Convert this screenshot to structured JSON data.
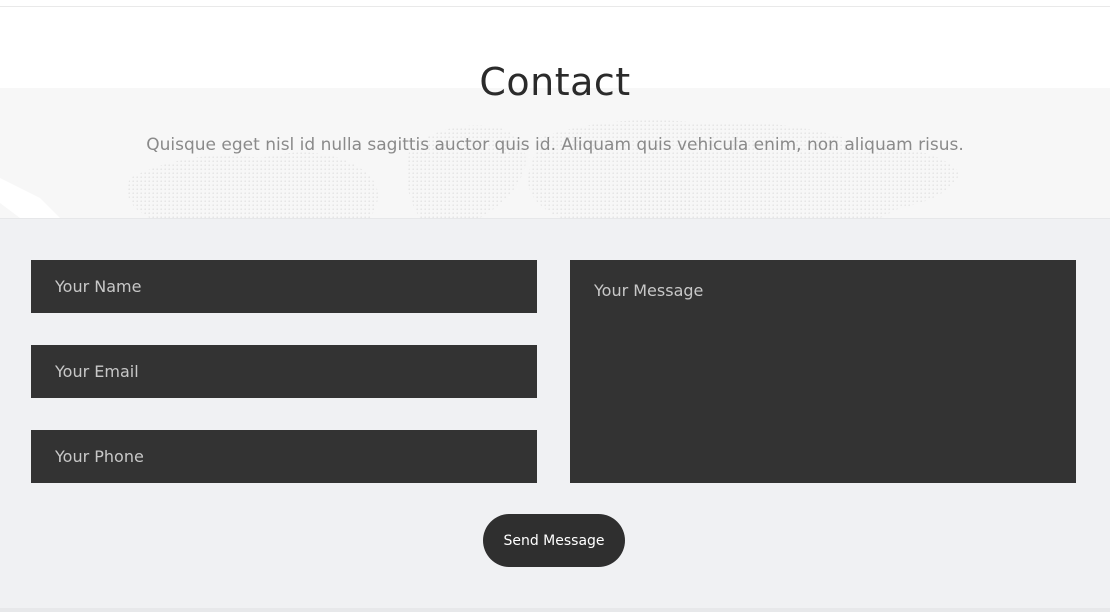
{
  "section": {
    "title": "Contact",
    "subtitle": "Quisque eget nisl id nulla sagittis auctor quis id. Aliquam quis vehicula enim, non aliquam risus."
  },
  "form": {
    "name_placeholder": "Your Name",
    "email_placeholder": "Your Email",
    "phone_placeholder": "Your Phone",
    "message_placeholder": "Your Message",
    "submit_label": "Send Message"
  },
  "colors": {
    "field_bg": "#333333",
    "button_bg": "#2f2f2f",
    "form_bg": "#f0f1f3",
    "title_text": "#2b2b2b",
    "subtitle_text": "#8a8a8a"
  }
}
